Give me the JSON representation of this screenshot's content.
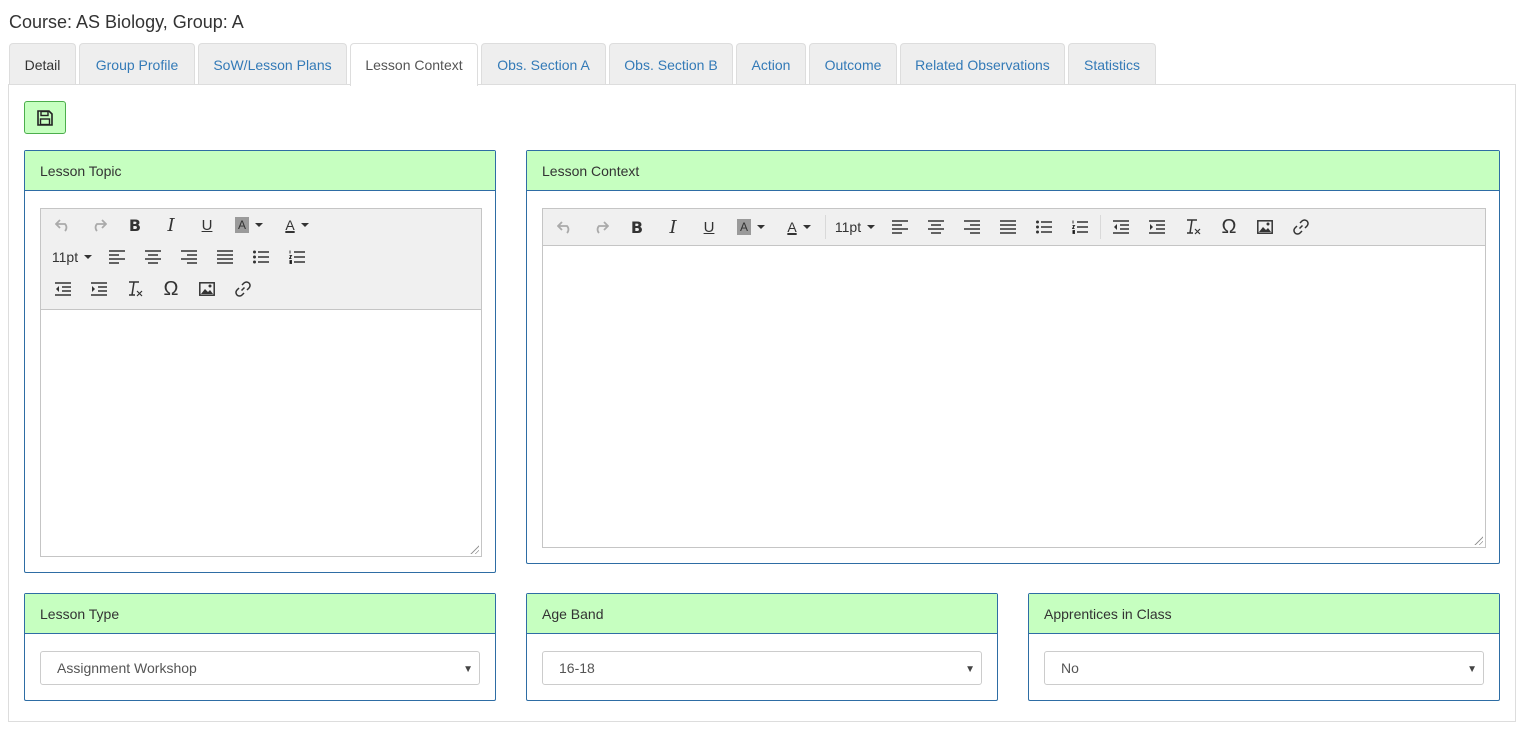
{
  "header": {
    "course_title": "Course: AS Biology, Group: A"
  },
  "tabs": [
    {
      "label": "Detail"
    },
    {
      "label": "Group Profile"
    },
    {
      "label": "SoW/Lesson Plans"
    },
    {
      "label": "Lesson Context"
    },
    {
      "label": "Obs. Section A"
    },
    {
      "label": "Obs. Section B"
    },
    {
      "label": "Action"
    },
    {
      "label": "Outcome"
    },
    {
      "label": "Related Observations"
    },
    {
      "label": "Statistics"
    }
  ],
  "active_tab": "Lesson Context",
  "save_button": {
    "icon": "floppy-disk-icon"
  },
  "panels": {
    "lesson_topic": {
      "title": "Lesson Topic",
      "font_size": "11pt"
    },
    "lesson_context": {
      "title": "Lesson Context",
      "font_size": "11pt"
    },
    "lesson_type": {
      "title": "Lesson Type",
      "value": "Assignment Workshop"
    },
    "age_band": {
      "title": "Age Band",
      "value": "16-18"
    },
    "apprentices": {
      "title": "Apprentices in Class",
      "value": "No"
    }
  },
  "toolbar_icons": {
    "undo": "undo-icon",
    "redo": "redo-icon",
    "bold": "B",
    "italic": "I",
    "underline": "U",
    "bg_color": "A",
    "text_color": "A",
    "omega": "Ω"
  },
  "colors": {
    "panel_header": "#c6ffc0",
    "panel_border": "#2e6da4",
    "link": "#337ab7"
  }
}
